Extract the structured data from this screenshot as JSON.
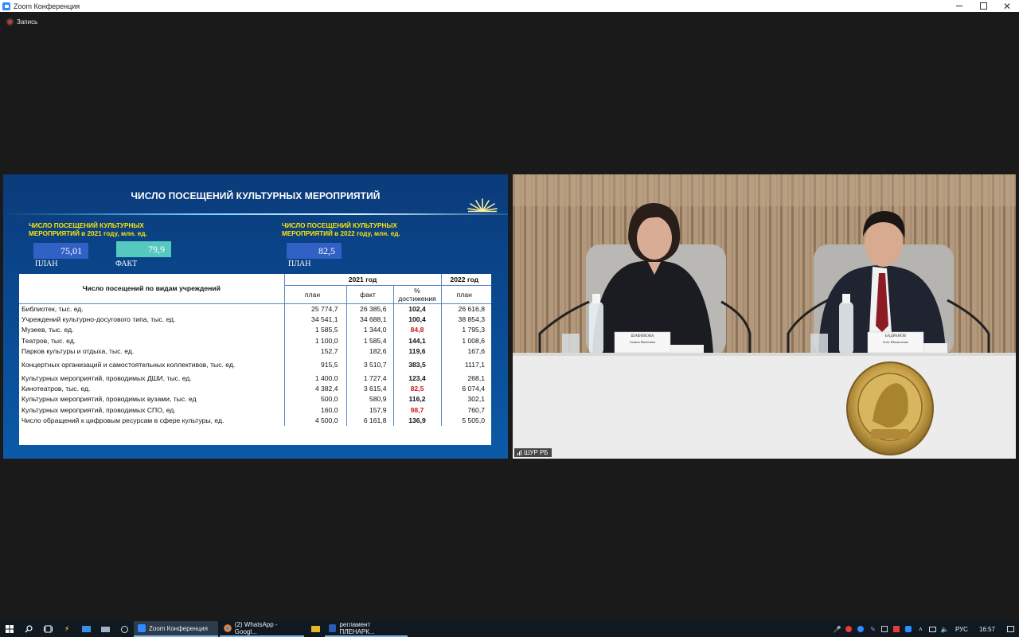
{
  "window": {
    "title": "Zoom Конференция",
    "recording_label": "Запись"
  },
  "slide": {
    "title": "ЧИСЛО ПОСЕЩЕНИЙ КУЛЬТУРНЫХ МЕРОПРИЯТИЙ",
    "left_label": "ЧИСЛО ПОСЕЩЕНИЙ КУЛЬТУРНЫХ МЕРОПРИЯТИЙ в 2021 году, млн. ед.",
    "right_label": "ЧИСЛО ПОСЕЩЕНИЙ КУЛЬТУРНЫХ МЕРОПРИЯТИЙ в 2022 году, млн. ед.",
    "plan_2021": "75,01",
    "fact_2021": "79,9",
    "plan_2022": "82,5",
    "cap_plan": "ПЛАН",
    "cap_fact": "ФАКТ",
    "table": {
      "header_main": "Число посещений по видам учреждений",
      "header_2021": "2021 год",
      "header_2022": "2022 год",
      "sub_plan": "план",
      "sub_fact": "факт",
      "sub_pct": "% достижения",
      "sub_plan_2022": "план",
      "rows": [
        {
          "name": "Библиотек, тыс. ед.",
          "plan": "25 774,7",
          "fact": "26 385,6",
          "pct": "102,4",
          "plan2022": "26 616,8",
          "red": false
        },
        {
          "name": "Учреждений культурно-досугового типа, тыс. ед.",
          "plan": "34 541,1",
          "fact": "34 688,1",
          "pct": "100,4",
          "plan2022": "38 854,3",
          "red": false
        },
        {
          "name": "Музеев, тыс. ед.",
          "plan": "1 585,5",
          "fact": "1 344,0",
          "pct": "84,8",
          "plan2022": "1 795,3",
          "red": true
        },
        {
          "name": "Театров, тыс. ед.",
          "plan": "1 100,0",
          "fact": "1 585,4",
          "pct": "144,1",
          "plan2022": "1 008,6",
          "red": false
        },
        {
          "name": "Парков культуры и отдыха, тыс. ед.",
          "plan": "152,7",
          "fact": "182,6",
          "pct": "119,6",
          "plan2022": "167,6",
          "red": false
        },
        {
          "name": "Концертных организаций и самостоятельных коллективов, тыс. ед.",
          "plan": "915,5",
          "fact": "3 510,7",
          "pct": "383,5",
          "plan2022": "1117,1",
          "red": false
        },
        {
          "name": "Культурных мероприятий, проводимых ДШИ, тыс. ед.",
          "plan": "1 400,0",
          "fact": "1 727,4",
          "pct": "123,4",
          "plan2022": "268,1",
          "red": false
        },
        {
          "name": "Кинотеатров, тыс. ед.",
          "plan": "4 382,4",
          "fact": "3 615,4",
          "pct": "82,5",
          "plan2022": "6 074,4",
          "red": true
        },
        {
          "name": "Культурных мероприятий, проводимых вузами, тыс. ед",
          "plan": "500,0",
          "fact": "580,9",
          "pct": "116,2",
          "plan2022": "302,1",
          "red": false
        },
        {
          "name": "Культурных мероприятий, проводимых СПО, ед.",
          "plan": "160,0",
          "fact": "157,9",
          "pct": "98,7",
          "plan2022": "760,7",
          "red": true
        },
        {
          "name": "Число обращений к цифровым ресурсам в сфере культуры, ед.",
          "plan": "4 500,0",
          "fact": "6 161,8",
          "pct": "136,9",
          "plan2022": "5 505,0",
          "red": false
        }
      ]
    }
  },
  "video": {
    "participant_tag": "ШУР РБ",
    "nameplate_left_surname": "ШАФИКОВА",
    "nameplate_left_name": "Амина Ивановна",
    "nameplate_right_surname": "БАДРАНОВ",
    "nameplate_right_name": "Азат Шамилевич"
  },
  "taskbar": {
    "apps": [
      {
        "label": "Zoom Конференция",
        "color": "#2d8cff",
        "active": true
      },
      {
        "label": "(2) WhatsApp - Googl...",
        "color": "#e8b428",
        "active": false
      },
      {
        "label": "регламент ПЛЕНАРК...",
        "color": "#2b5cb8",
        "active": false
      }
    ],
    "lang": "РУС",
    "time": "16:57"
  },
  "colors": {
    "slide_bg": "#0a4a92",
    "label_yellow": "#ffe600",
    "box_blue": "#3161c4",
    "box_teal": "#55c9c0",
    "pct_red": "#cc1a1a"
  }
}
